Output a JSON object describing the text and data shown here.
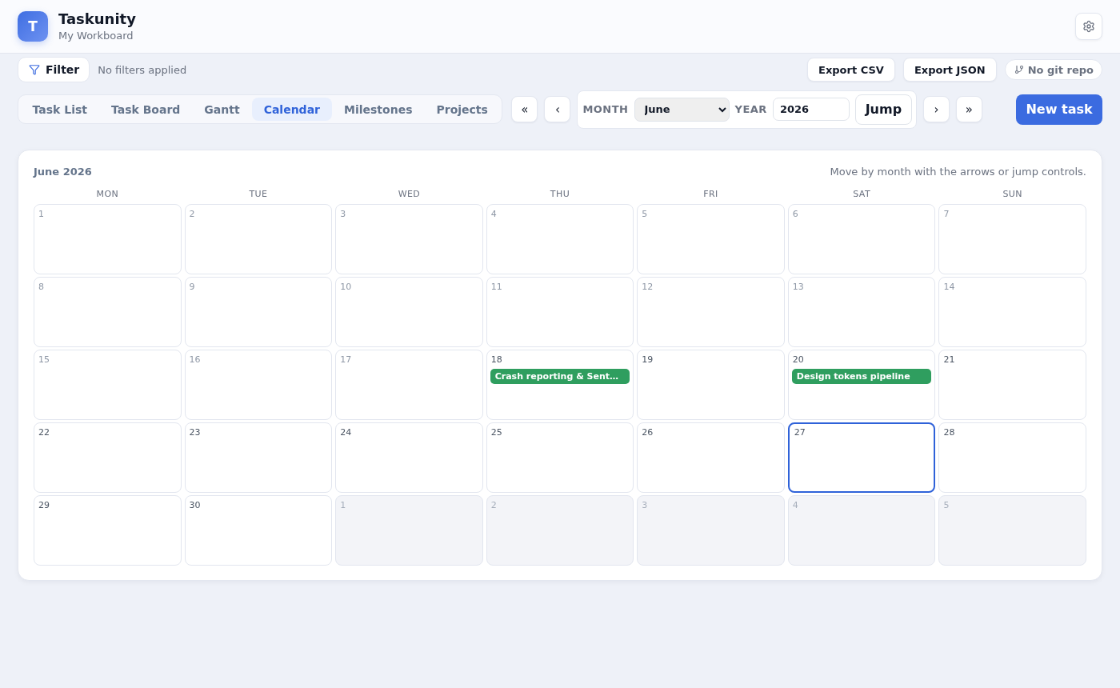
{
  "app": {
    "logo": "T",
    "title": "Taskunity",
    "subtitle": "My Workboard"
  },
  "toolbar": {
    "filter_button": "Filter",
    "filter_status": "No filters applied",
    "actions": [
      "Export CSV",
      "Export JSON"
    ],
    "git_status": "No git repo"
  },
  "tabs": [
    {
      "label": "Task List",
      "selected": false
    },
    {
      "label": "Task Board",
      "selected": false
    },
    {
      "label": "Gantt",
      "selected": false
    },
    {
      "label": "Calendar",
      "selected": true
    },
    {
      "label": "Milestones",
      "selected": false
    },
    {
      "label": "Projects",
      "selected": false
    }
  ],
  "navigation": {
    "first": "«",
    "previous": "‹",
    "month_label": "MONTH",
    "month": "June",
    "year_label": "YEAR",
    "year": "2026",
    "jump": "Jump",
    "next": "›",
    "last": "»"
  },
  "new_task": "New task",
  "calendar": {
    "title": "June 2026",
    "hint": "Move by month with the arrows or jump controls.",
    "weekdays": [
      "MON",
      "TUE",
      "WED",
      "THU",
      "FRI",
      "SAT",
      "SUN"
    ],
    "days": [
      {
        "day": "1",
        "kind": "muted",
        "today": false
      },
      {
        "day": "2",
        "kind": "muted",
        "today": false
      },
      {
        "day": "3",
        "kind": "muted",
        "today": false
      },
      {
        "day": "4",
        "kind": "muted",
        "today": false
      },
      {
        "day": "5",
        "kind": "muted",
        "today": false
      },
      {
        "day": "6",
        "kind": "muted",
        "today": false
      },
      {
        "day": "7",
        "kind": "muted",
        "today": false
      },
      {
        "day": "8",
        "kind": "muted",
        "today": false
      },
      {
        "day": "9",
        "kind": "muted",
        "today": false
      },
      {
        "day": "10",
        "kind": "muted",
        "today": false
      },
      {
        "day": "11",
        "kind": "muted",
        "today": false
      },
      {
        "day": "12",
        "kind": "muted",
        "today": false
      },
      {
        "day": "13",
        "kind": "muted",
        "today": false
      },
      {
        "day": "14",
        "kind": "muted",
        "today": false
      },
      {
        "day": "15",
        "kind": "muted",
        "today": false
      },
      {
        "day": "16",
        "kind": "muted",
        "today": false
      },
      {
        "day": "17",
        "kind": "muted",
        "today": false
      },
      {
        "day": "18",
        "kind": "normal",
        "today": false,
        "events": [
          {
            "title": "Crash reporting & Sent…",
            "color": "#2f9e5f"
          }
        ]
      },
      {
        "day": "19",
        "kind": "normal",
        "today": false
      },
      {
        "day": "20",
        "kind": "normal",
        "today": false,
        "events": [
          {
            "title": "Design tokens pipeline",
            "color": "#2f9e5f"
          }
        ]
      },
      {
        "day": "21",
        "kind": "normal",
        "today": false
      },
      {
        "day": "22",
        "kind": "normal",
        "today": false
      },
      {
        "day": "23",
        "kind": "normal",
        "today": false
      },
      {
        "day": "24",
        "kind": "normal",
        "today": false
      },
      {
        "day": "25",
        "kind": "normal",
        "today": false
      },
      {
        "day": "26",
        "kind": "normal",
        "today": false
      },
      {
        "day": "27",
        "kind": "normal",
        "today": true
      },
      {
        "day": "28",
        "kind": "normal",
        "today": false
      },
      {
        "day": "29",
        "kind": "normal",
        "today": false
      },
      {
        "day": "30",
        "kind": "normal",
        "today": false
      },
      {
        "day": "1",
        "kind": "outside",
        "today": false
      },
      {
        "day": "2",
        "kind": "outside",
        "today": false
      },
      {
        "day": "3",
        "kind": "outside",
        "today": false
      },
      {
        "day": "4",
        "kind": "outside",
        "today": false
      },
      {
        "day": "5",
        "kind": "outside",
        "today": false
      }
    ]
  }
}
